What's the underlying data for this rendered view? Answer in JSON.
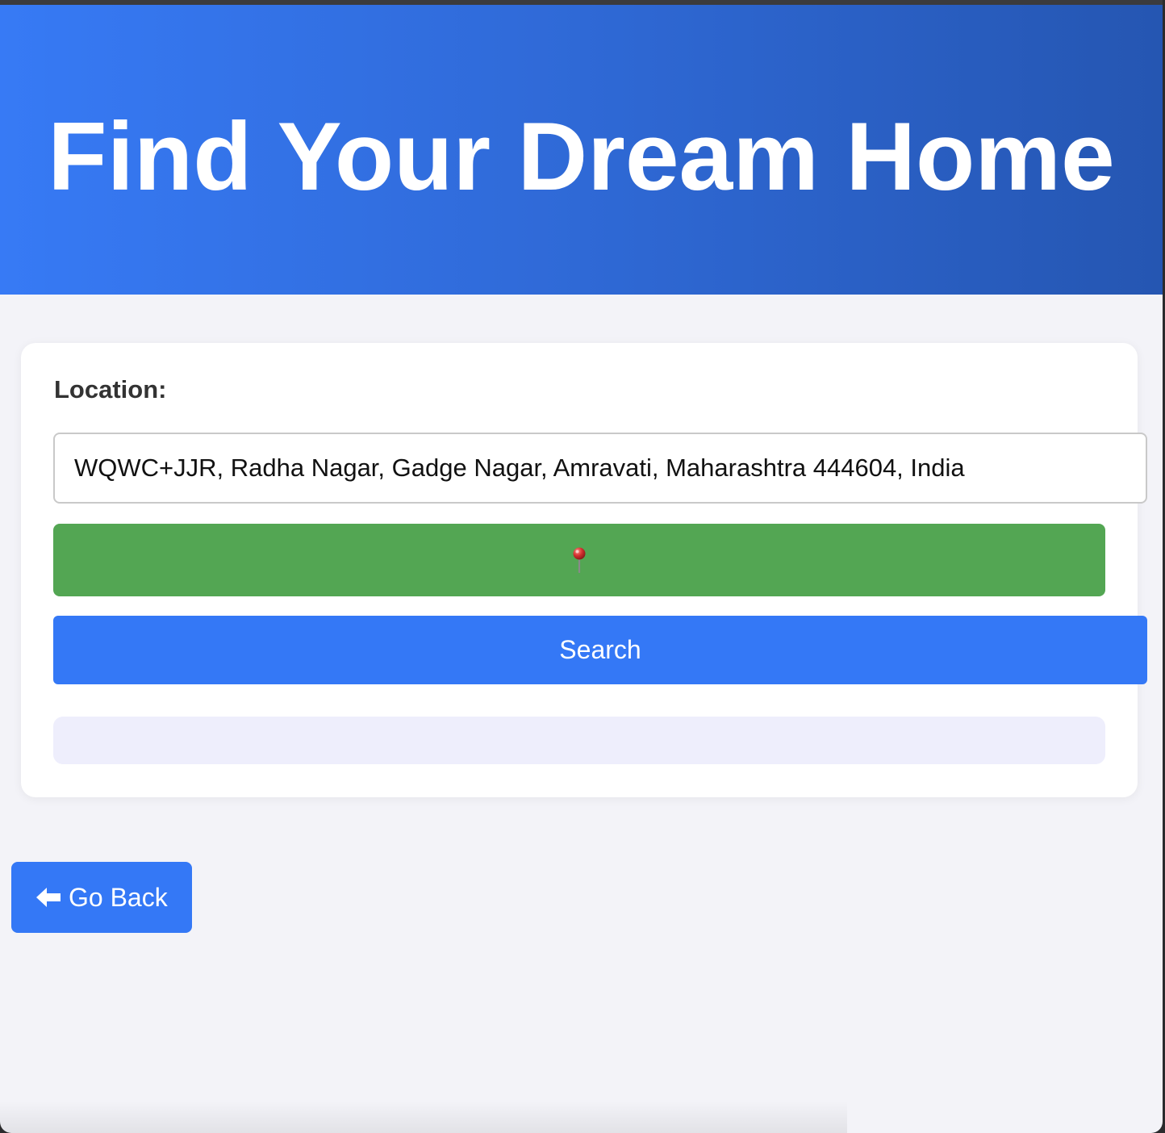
{
  "hero": {
    "title": "Find Your Dream Home",
    "gradient_start": "#377af5",
    "gradient_end": "#2556b2"
  },
  "search_form": {
    "location_label": "Location:",
    "location_value": "WQWC+JJR, Radha Nagar, Gadge Nagar, Amravati, Maharashtra 444604, India",
    "locate_button_icon": "pushpin-icon",
    "search_button_label": "Search",
    "results_text": ""
  },
  "navigation": {
    "back_button_label": "Go Back",
    "back_button_icon": "arrow-left-icon"
  },
  "colors": {
    "primary": "#3478f6",
    "locate_green": "#53a653",
    "page_background": "#f3f3f8",
    "results_background": "#eeeefc"
  }
}
